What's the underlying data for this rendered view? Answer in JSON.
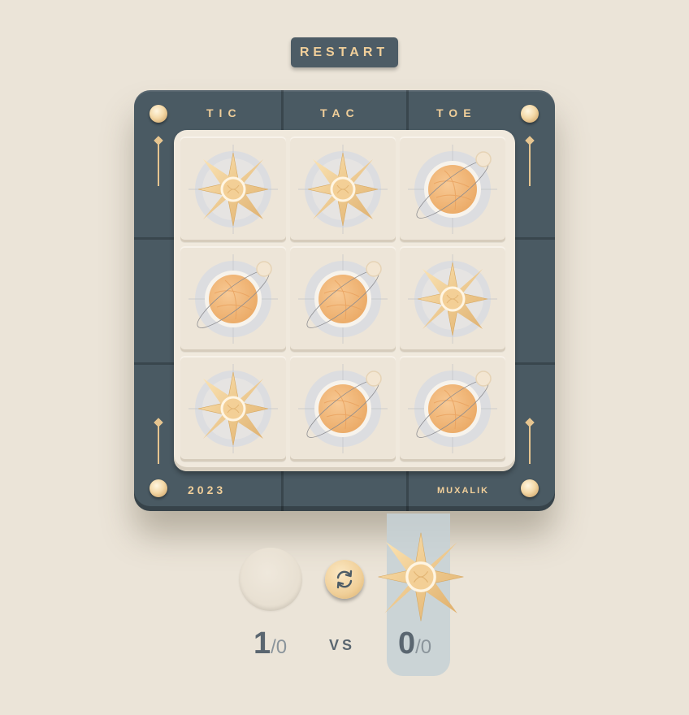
{
  "restart_label": "RESTART",
  "frame": {
    "top_labels": [
      "TIC",
      "TAC",
      "TOE"
    ],
    "year": "2023",
    "author": "MUXALIK"
  },
  "board": [
    [
      "x",
      "x",
      "o"
    ],
    [
      "o",
      "o",
      "x"
    ],
    [
      "x",
      "o",
      "o"
    ]
  ],
  "current_turn": "x",
  "score": {
    "o": {
      "wins": "1",
      "total": "/0"
    },
    "vs": "VS",
    "x": {
      "wins": "0",
      "total": "/0"
    }
  },
  "colors": {
    "background": "#ebe4d8",
    "frame": "#4a5a63",
    "accent_gold": "#f1cf9a",
    "board": "#f0e9dd",
    "turn_highlight": "#c6d1d6"
  },
  "icons": {
    "x": "star-compass-icon",
    "o": "planet-icon",
    "swap": "swap-arrows-icon"
  }
}
